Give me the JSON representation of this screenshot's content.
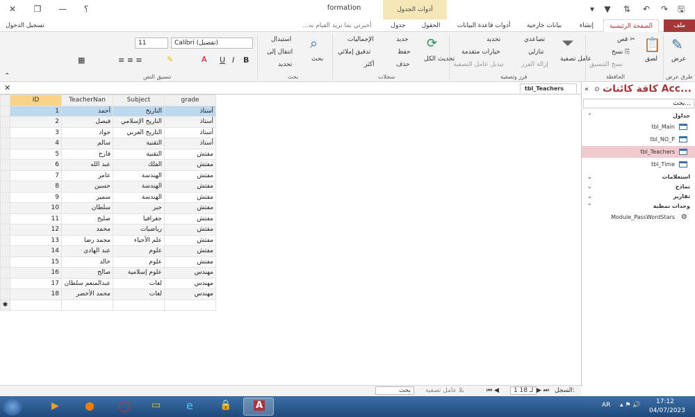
{
  "titlebar": {
    "title": "formation",
    "contextual_label": "أدوات الجدول",
    "help": "؟"
  },
  "tabs": [
    "ملف",
    "الصفحة الرئيسية",
    "إنشاء",
    "بيانات خارجية",
    "أدوات قاعدة البيانات",
    "الحقول",
    "جدول"
  ],
  "tell_me": "أخبرني بما تريد القيام به...",
  "sign_in": "تسجيل الدخول",
  "ribbon": {
    "views": {
      "view": "عرض",
      "group": "طرق عرض"
    },
    "clipboard": {
      "paste": "لصق",
      "cut": "قص",
      "copy": "نسخ",
      "format_painter": "نسخ التنسيق",
      "group": "الحافظة"
    },
    "sort": {
      "filter": "عامل\nتصفية",
      "ascending": "تصاعدي",
      "descending": "تنازلي",
      "remove_sort": "إزالة الفرز",
      "selection": "تحديد",
      "advanced": "خيارات متقدمة",
      "toggle": "تبديل عامل التصفية",
      "group": "فرز وتصفية"
    },
    "records": {
      "refresh": "تحديث\nالكل",
      "new": "جديد",
      "save": "حفظ",
      "delete": "حذف",
      "totals": "الإجماليات",
      "spelling": "تدقيق إملائي",
      "more": "أكثر",
      "group": "سجلات"
    },
    "find": {
      "find": "بحث",
      "replace": "استبدال",
      "goto": "انتقال إلى",
      "select": "تحديد",
      "group": "بحث"
    },
    "text": {
      "font": "Calibri (تفصيل)",
      "size": "11",
      "group": "تنسيق النص"
    }
  },
  "nav": {
    "title": "كافة كائنات Acc...",
    "search_placeholder": "بحث...",
    "sections": {
      "tables": "جداول",
      "queries": "استعلامات",
      "forms": "نماذج",
      "reports": "تقارير",
      "modules": "وحدات نمطية"
    },
    "tables": [
      "tbl_Main",
      "tbl_NO_P",
      "tbl_Teachers",
      "tbl_Time"
    ],
    "module": "Module_PassWordStars"
  },
  "doc_tab": "tbl_Teachers",
  "grid": {
    "columns": [
      "ID",
      "TeacherNan",
      "Subject",
      "grade"
    ],
    "rows": [
      [
        "1",
        "أحمد",
        "التاريخ",
        "أستاذ"
      ],
      [
        "2",
        "فيصل",
        "التاريخ الإسلامي",
        "أستاذ"
      ],
      [
        "3",
        "جواد",
        "التاريخ العربي",
        "أستاذ"
      ],
      [
        "4",
        "سالم",
        "التقنية",
        "أستاذ"
      ],
      [
        "5",
        "فارح",
        "التقنية",
        "مفتش"
      ],
      [
        "6",
        "عبد الله",
        "الفلك",
        "مفتش"
      ],
      [
        "7",
        "عامر",
        "الهندسة",
        "مفتش"
      ],
      [
        "8",
        "حسين",
        "الهندسة",
        "مفتش"
      ],
      [
        "9",
        "سمير",
        "الهندسة",
        "مفتش"
      ],
      [
        "10",
        "سلطان",
        "جبر",
        "مفتش"
      ],
      [
        "11",
        "صليح",
        "جغرافيا",
        "مفتش"
      ],
      [
        "12",
        "محمد",
        "رياضيات",
        "مفتش"
      ],
      [
        "13",
        "محمد رضا",
        "علم الأحياء",
        "مفتش"
      ],
      [
        "14",
        "عبد الهادي",
        "علوم",
        "مفتش"
      ],
      [
        "15",
        "خالد",
        "علوم",
        "مفتش"
      ],
      [
        "16",
        "صالح",
        "علوم إسلامية",
        "مهندس"
      ],
      [
        "17",
        "عبدالمنعم سلطان",
        "لغات",
        "مهندس"
      ],
      [
        "18",
        "محمد الأخضر",
        "لغات",
        "مهندس"
      ]
    ]
  },
  "record_nav": {
    "label": "السجل:",
    "position": "1 لـ 18",
    "filter": "بلا عامل تصفية",
    "search": "بحث"
  },
  "taskbar": {
    "lang": "AR",
    "time": "17:12",
    "date": "04/07/2023"
  }
}
